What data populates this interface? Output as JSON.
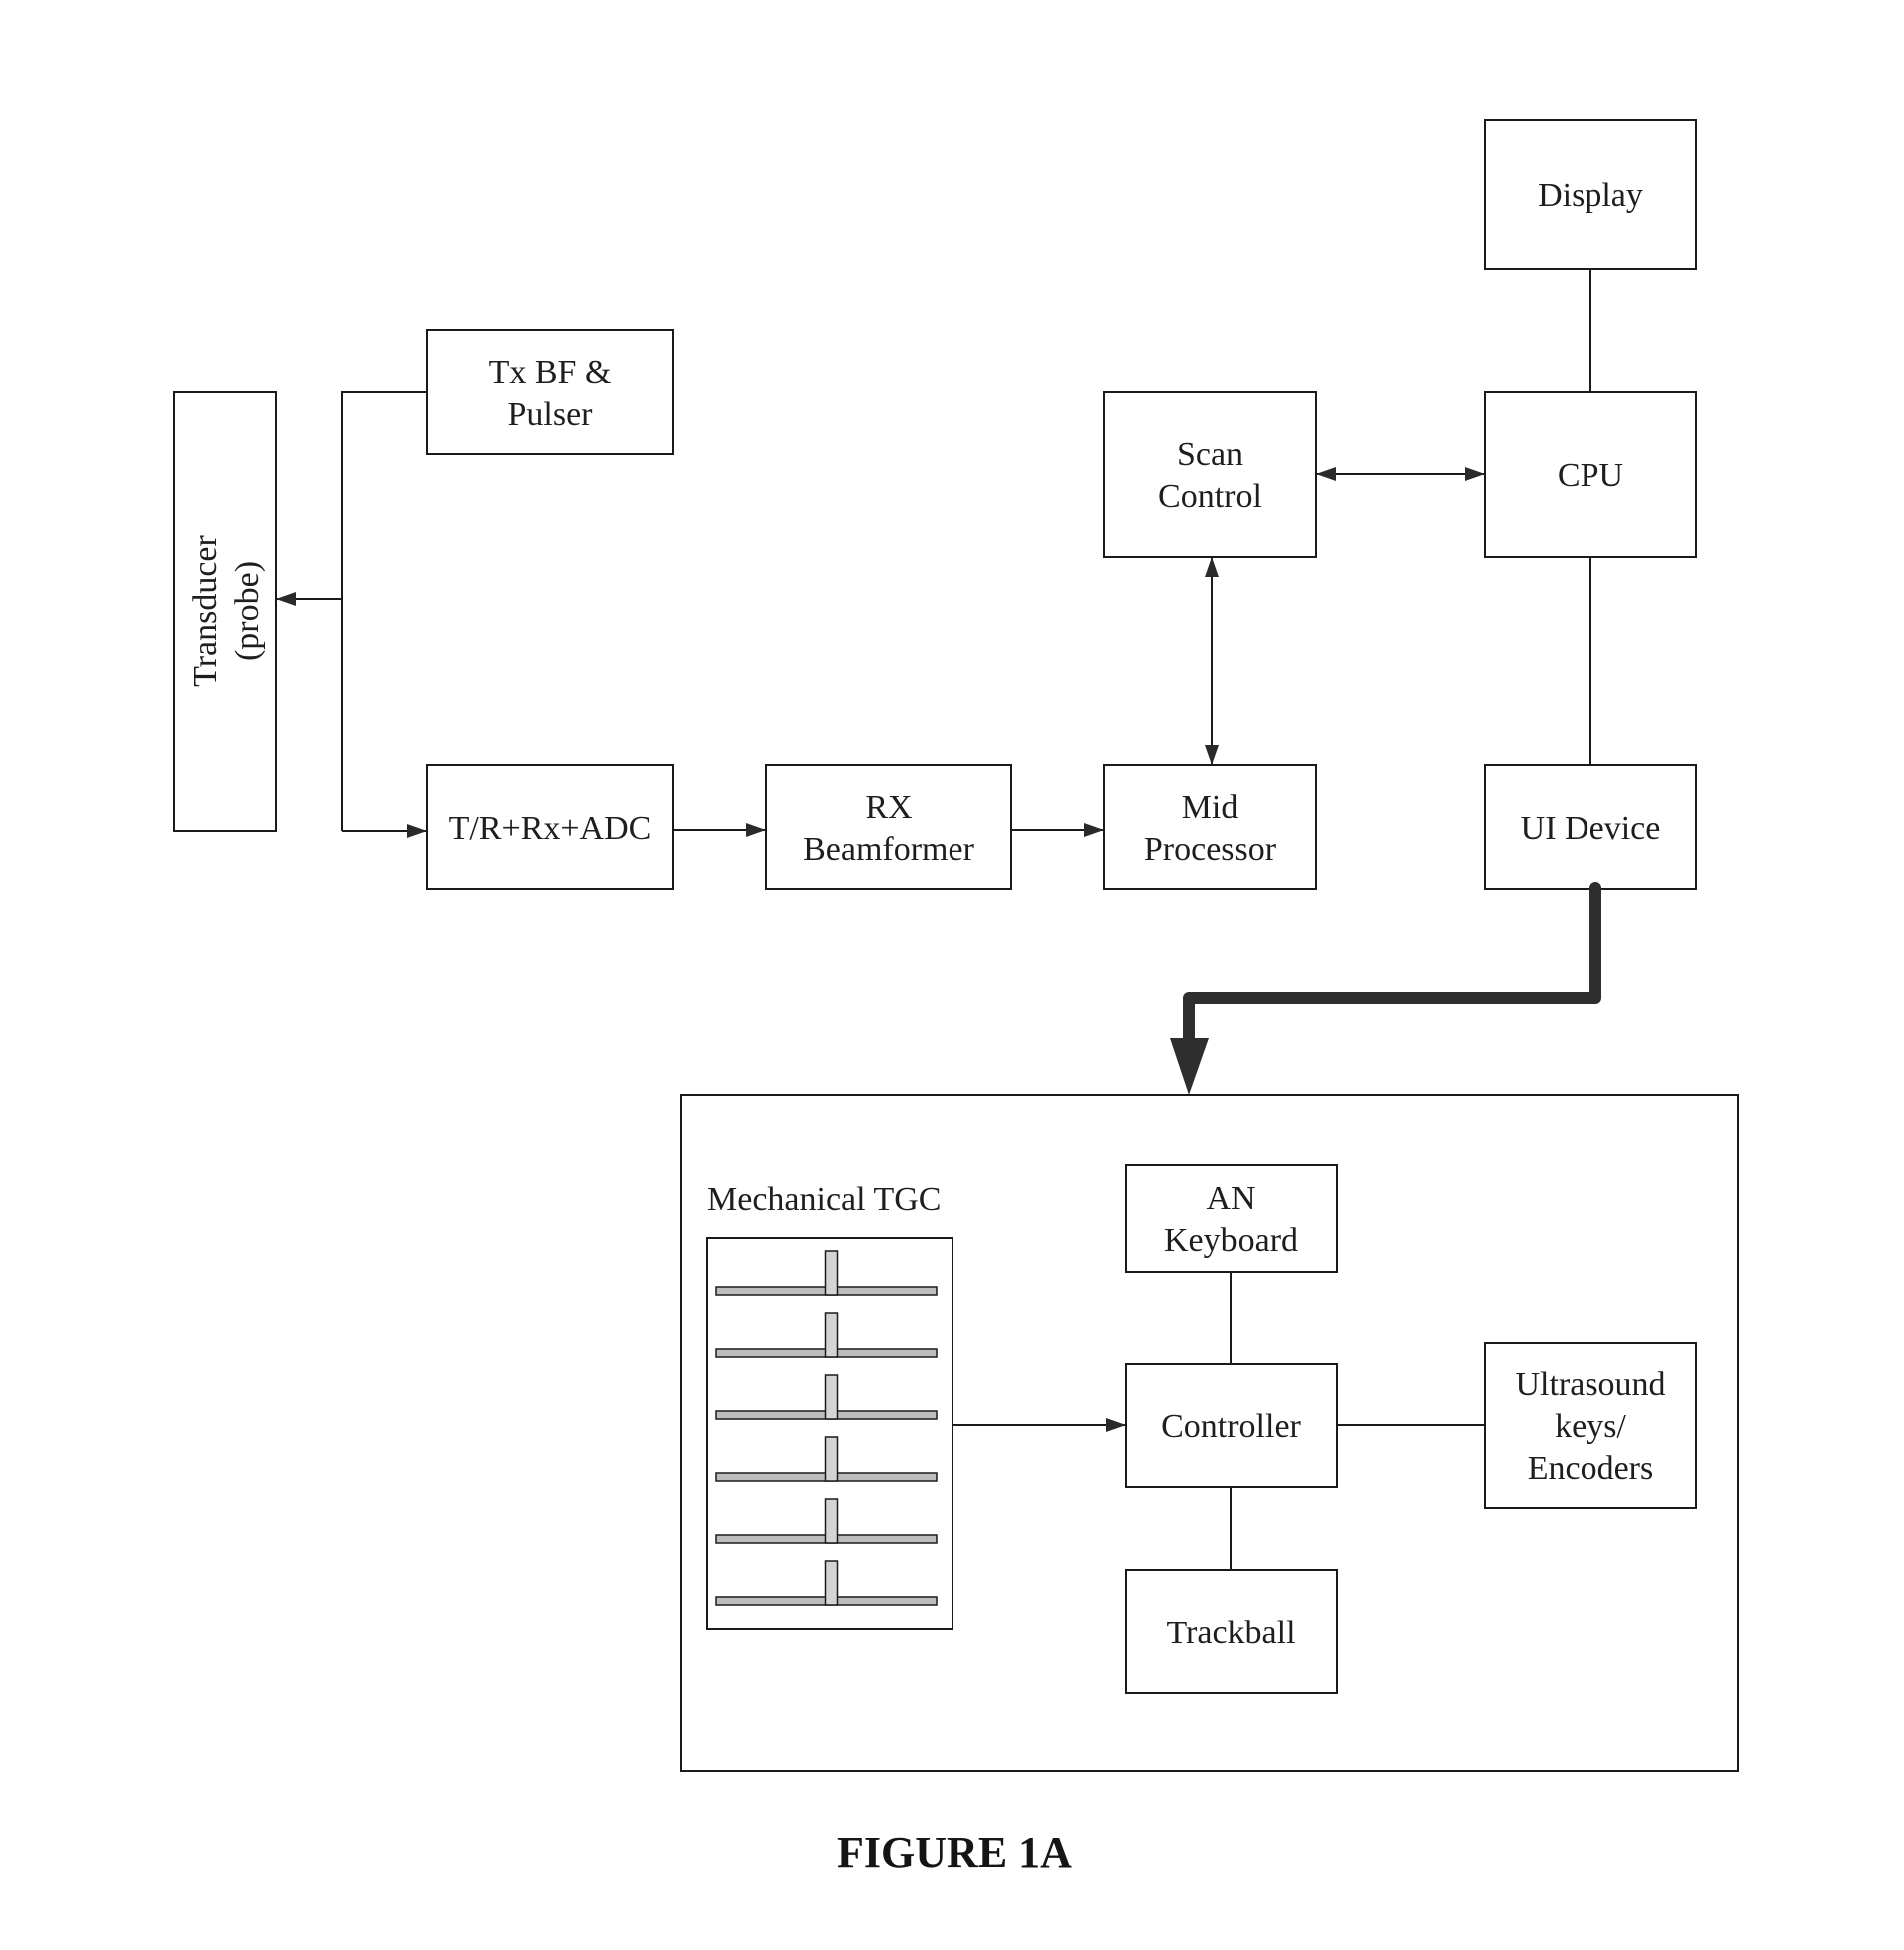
{
  "figure": {
    "caption": "FIGURE 1A"
  },
  "blocks": {
    "transducer": [
      "Transducer",
      "(probe)"
    ],
    "tx_bf_pulser": [
      "Tx BF &",
      "Pulser"
    ],
    "tr_rx_adc": [
      "T/R+Rx+ADC"
    ],
    "rx_beamformer": [
      "RX",
      "Beamformer"
    ],
    "mid_processor": [
      "Mid",
      "Processor"
    ],
    "scan_control": [
      "Scan",
      "Control"
    ],
    "cpu": [
      "CPU"
    ],
    "display": [
      "Display"
    ],
    "ui_device": [
      "UI Device"
    ],
    "an_keyboard": [
      "AN",
      "Keyboard"
    ],
    "controller": [
      "Controller"
    ],
    "trackball": [
      "Trackball"
    ],
    "ultrasound_keys": [
      "Ultrasound",
      "keys/",
      "Encoders"
    ]
  },
  "ui_device_panel": {
    "tgc_label": "Mechanical TGC",
    "tgc_slider_count": 6,
    "tgc_slider_positions": [
      0.5,
      0.5,
      0.5,
      0.5,
      0.5,
      0.5
    ]
  },
  "connections": [
    {
      "from": "tx_bf_pulser",
      "to": "transducer",
      "type": "arrow"
    },
    {
      "from": "transducer",
      "to": "tr_rx_adc",
      "type": "arrow"
    },
    {
      "from": "tr_rx_adc",
      "to": "rx_beamformer",
      "type": "arrow"
    },
    {
      "from": "rx_beamformer",
      "to": "mid_processor",
      "type": "arrow"
    },
    {
      "from": "mid_processor",
      "to": "scan_control",
      "type": "bidirectional"
    },
    {
      "from": "scan_control",
      "to": "cpu",
      "type": "bidirectional"
    },
    {
      "from": "cpu",
      "to": "display",
      "type": "line"
    },
    {
      "from": "cpu",
      "to": "ui_device",
      "type": "line"
    },
    {
      "from": "ui_device",
      "to": "ui_device_panel",
      "type": "thick-arrow"
    },
    {
      "from": "mechanical_tgc",
      "to": "controller",
      "type": "arrow"
    },
    {
      "from": "an_keyboard",
      "to": "controller",
      "type": "line"
    },
    {
      "from": "controller",
      "to": "trackball",
      "type": "line"
    },
    {
      "from": "controller",
      "to": "ultrasound_keys",
      "type": "line"
    }
  ],
  "colors": {
    "stroke": "#1a1a1a",
    "thick_arrow": "#2e2e2e",
    "slider_fill": "#c8c8c8"
  }
}
